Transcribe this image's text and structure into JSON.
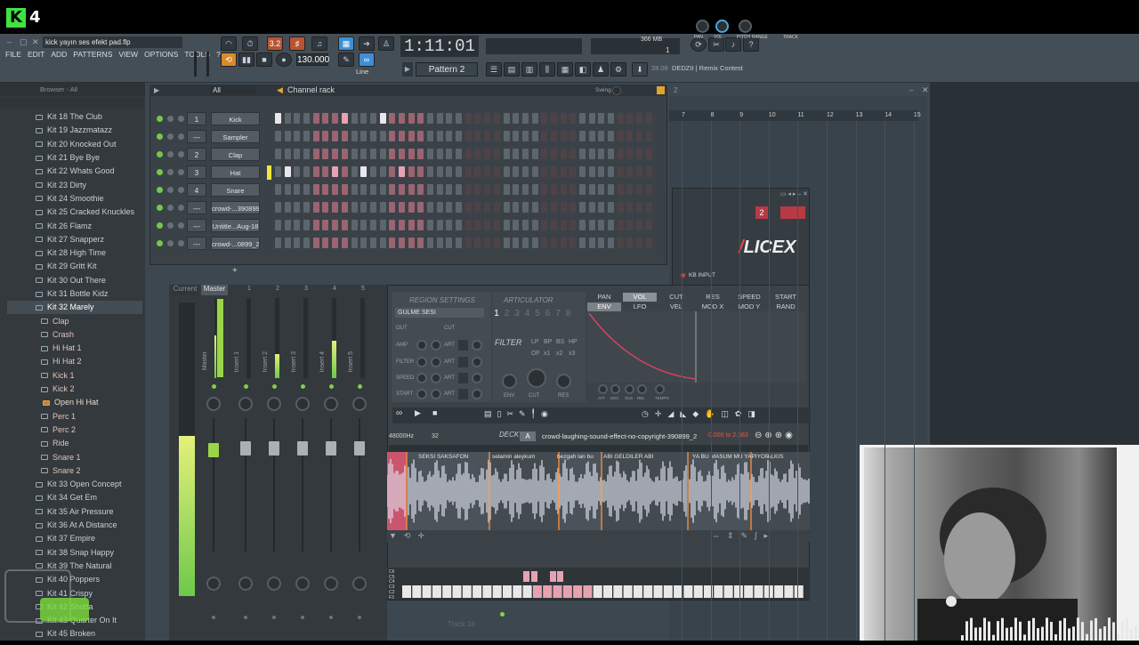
{
  "overlay": {
    "badge": "K",
    "count": "4"
  },
  "window": {
    "title": "kick yayın ses efekt pad.flp"
  },
  "menu": [
    "FILE",
    "EDIT",
    "ADD",
    "PATTERNS",
    "VIEW",
    "OPTIONS",
    "TOOLS",
    "?"
  ],
  "transport": {
    "time": "1:11:01",
    "bpm": "130.000",
    "pattern": "Pattern 2",
    "snap": "Line",
    "cpu_mem": "366 MB",
    "voices": "1"
  },
  "news": {
    "date": "28.08",
    "text": "DEDZII | Remix Contest"
  },
  "browser": {
    "header": "Browser - All",
    "items": [
      {
        "label": "Kit 18 The Club",
        "type": "kit"
      },
      {
        "label": "Kit 19 Jazzmatazz",
        "type": "kit"
      },
      {
        "label": "Kit 20 Knocked Out",
        "type": "kit"
      },
      {
        "label": "Kit 21 Bye Bye",
        "type": "kit"
      },
      {
        "label": "Kit 22 Whats Good",
        "type": "kit"
      },
      {
        "label": "Kit 23 Dirty",
        "type": "kit"
      },
      {
        "label": "Kit 24 Smoothie",
        "type": "kit"
      },
      {
        "label": "Kit 25 Cracked Knuckles",
        "type": "kit"
      },
      {
        "label": "Kit 26 Flamz",
        "type": "kit"
      },
      {
        "label": "Kit 27 Snapperz",
        "type": "kit"
      },
      {
        "label": "Kit 28 High Time",
        "type": "kit"
      },
      {
        "label": "Kit 29 Gritt Kit",
        "type": "kit"
      },
      {
        "label": "Kit 30 Out There",
        "type": "kit"
      },
      {
        "label": "Kit 31 Bottle Kidz",
        "type": "kit"
      },
      {
        "label": "Kit 32 Marely",
        "type": "kit-sel"
      },
      {
        "label": "Clap",
        "type": "folder"
      },
      {
        "label": "Crash",
        "type": "folder"
      },
      {
        "label": "Hi Hat 1",
        "type": "folder"
      },
      {
        "label": "Hi Hat 2",
        "type": "folder"
      },
      {
        "label": "Kick 1",
        "type": "folder"
      },
      {
        "label": "Kick 2",
        "type": "folder"
      },
      {
        "label": "Open Hi Hat",
        "type": "file"
      },
      {
        "label": "Perc 1",
        "type": "folder"
      },
      {
        "label": "Perc 2",
        "type": "folder"
      },
      {
        "label": "Ride",
        "type": "folder"
      },
      {
        "label": "Snare 1",
        "type": "folder"
      },
      {
        "label": "Snare 2",
        "type": "folder"
      },
      {
        "label": "Kit 33 Open Concept",
        "type": "kit"
      },
      {
        "label": "Kit 34 Get Em",
        "type": "kit"
      },
      {
        "label": "Kit 35 Air Pressure",
        "type": "kit"
      },
      {
        "label": "Kit 36 At A Distance",
        "type": "kit"
      },
      {
        "label": "Kit 37 Empire",
        "type": "kit"
      },
      {
        "label": "Kit 38 Snap Happy",
        "type": "kit"
      },
      {
        "label": "Kit 39 The Natural",
        "type": "kit"
      },
      {
        "label": "Kit 40 Poppers",
        "type": "kit"
      },
      {
        "label": "Kit 41 Crispy",
        "type": "kit"
      },
      {
        "label": "Kit 42 Shotta",
        "type": "kit"
      },
      {
        "label": "Kit 43 Quarter On It",
        "type": "kit"
      },
      {
        "label": "Kit 45 Broken",
        "type": "kit"
      }
    ]
  },
  "channel_rack": {
    "title": "Channel rack",
    "filter": "All",
    "swing_label": "Swing",
    "channels": [
      {
        "num": "1",
        "name": "Kick",
        "steps": "1000000100010000"
      },
      {
        "num": "---",
        "name": "Sampler",
        "steps": "0000000000000000"
      },
      {
        "num": "2",
        "name": "Clap",
        "steps": "0000000000000000"
      },
      {
        "num": "3",
        "name": "Hat",
        "steps": "0100001001000100"
      },
      {
        "num": "4",
        "name": "Snare",
        "steps": "0000000000000000"
      },
      {
        "num": "---",
        "name": "crowd-...390899",
        "steps": "0000000000000000"
      },
      {
        "num": "---",
        "name": "Untitle...Aug-18",
        "steps": "0000000000000000"
      },
      {
        "num": "---",
        "name": "crowd-...0899_2",
        "steps": "0000000000000000"
      }
    ]
  },
  "playlist": {
    "bars": [
      "7",
      "8",
      "9",
      "10",
      "11",
      "12",
      "13",
      "14",
      "15"
    ]
  },
  "mixer": {
    "tabs": [
      "Current",
      "Master"
    ],
    "tracks": [
      "Master",
      "Insert 1",
      "Insert 2",
      "Insert 3",
      "Insert 4",
      "Insert 5"
    ],
    "numbers": [
      "1",
      "2",
      "3",
      "4",
      "5"
    ]
  },
  "slicex": {
    "logo_a": "/",
    "logo_b": "LICEX",
    "kb_input": "KB INPUT",
    "knobs": [
      "PAN",
      "VOL",
      "PITCH",
      "RANGE",
      "TRACK"
    ],
    "region_settings": "REGION SETTINGS",
    "region_name": "GULME SESI",
    "articulator": "ARTICULATOR",
    "articulator_nums": [
      "1",
      "2",
      "3",
      "4",
      "5",
      "6",
      "7",
      "8"
    ],
    "filter": "FILTER",
    "filter_types": [
      "LP",
      "BP",
      "BS",
      "HP",
      "OF",
      "x1",
      "x2",
      "x3"
    ],
    "left_labels": [
      "OUT",
      "CUT",
      "AMP",
      "ART",
      "FILTER",
      "ART",
      "SPEED",
      "ART",
      "START",
      "ART"
    ],
    "art_knobs": [
      "ENV",
      "CUT",
      "RES"
    ],
    "env_tabs_row1": [
      "PAN",
      "VOL",
      "CUT",
      "RES",
      "SPEED",
      "START"
    ],
    "env_tabs_row2": [
      "ENV",
      "LFO",
      "VEL",
      "MOD X",
      "MOD Y",
      "RAND"
    ],
    "env_knob_labels": [
      "ATT",
      "DEC",
      "SUS",
      "REL",
      "TEMPO"
    ],
    "deck_label": "DECK",
    "deck_id": "A",
    "sample_rate": "48000Hz",
    "bits": "32",
    "sample_file": "crowd-laughing-sound-effect-no-copyright-390899_2",
    "sample_range": "0.000 to 2.383",
    "slice_labels": [
      "SEKSI SAKSAFON",
      "selamin aleykum",
      "bezgah lan bu",
      "ABI GELDILER ABI",
      "YA BU MASUM MU YAPIYOR",
      "ALKIS"
    ]
  },
  "keyboard": {
    "labels": [
      "C6",
      "C5",
      "C4",
      "C3",
      "C2",
      "F3"
    ]
  },
  "playlist_track": "Track 16"
}
